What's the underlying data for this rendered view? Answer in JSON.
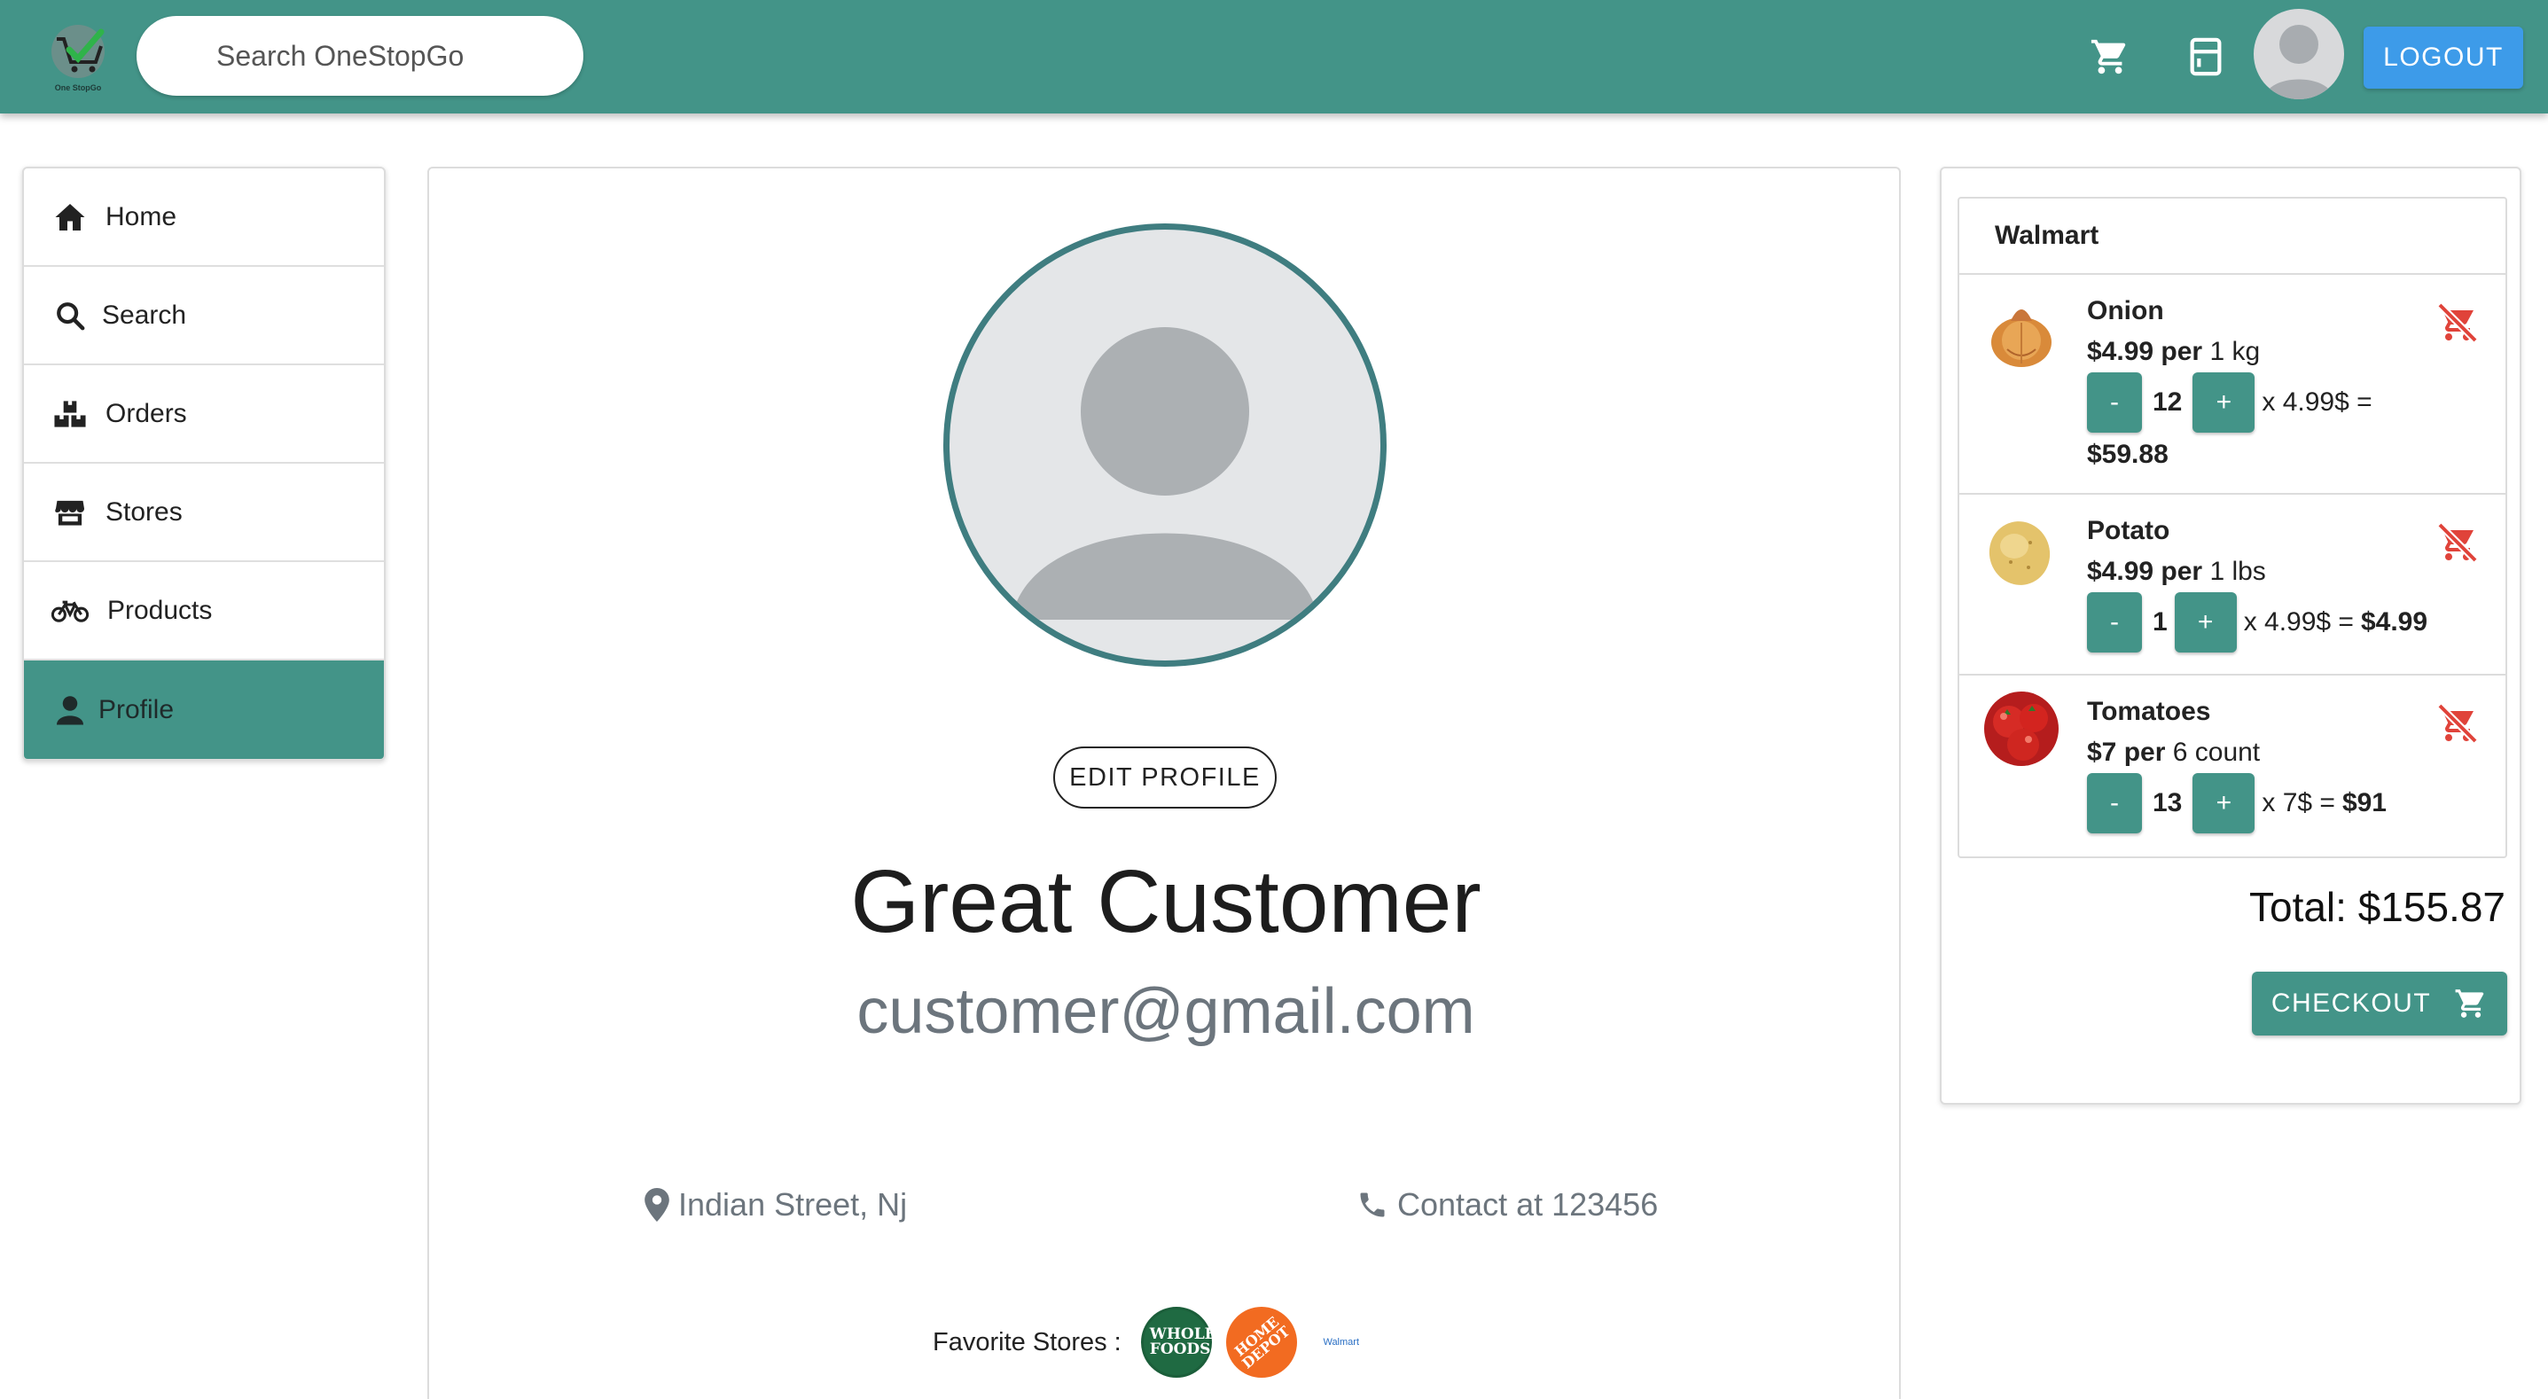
{
  "topbar": {
    "logo_text": "One StopGo",
    "search_placeholder": "Search OneStopGo",
    "logout_label": "LOGOUT",
    "icons": [
      "cart-icon",
      "receipt-icon",
      "avatar"
    ]
  },
  "sidebar": {
    "items": [
      {
        "label": "Home",
        "icon": "home-icon"
      },
      {
        "label": "Search",
        "icon": "search-icon"
      },
      {
        "label": "Orders",
        "icon": "boxes-icon"
      },
      {
        "label": "Stores",
        "icon": "store-icon"
      },
      {
        "label": "Products",
        "icon": "bicycle-icon"
      },
      {
        "label": "Profile",
        "icon": "user-icon",
        "active": true
      }
    ]
  },
  "profile": {
    "edit_label": "EDIT PROFILE",
    "name": "Great Customer",
    "email": "customer@gmail.com",
    "address": "Indian Street, Nj",
    "contact": "Contact at 123456",
    "favorite_label": "Favorite Stores :",
    "favorite_stores": [
      "WHOLE FOODS",
      "HOME DEPOT",
      "Walmart"
    ]
  },
  "cart": {
    "store": "Walmart",
    "items": [
      {
        "name": "Onion",
        "price": "$4.99 per",
        "unit": "1 kg",
        "qty": "12",
        "mult": "x 4.99$ =",
        "line_total": "$59.88"
      },
      {
        "name": "Potato",
        "price": "$4.99 per",
        "unit": "1 lbs",
        "qty": "1",
        "mult": "x 4.99$ =",
        "line_total": "$4.99"
      },
      {
        "name": "Tomatoes",
        "price": "$7 per",
        "unit": "6 count",
        "qty": "13",
        "mult": "x 7$ =",
        "line_total": "$91"
      }
    ],
    "minus": "-",
    "plus": "+",
    "total": "Total: $155.87",
    "checkout_label": "CHECKOUT"
  },
  "colors": {
    "primary": "#439488",
    "logout": "#3d9be9",
    "remove": "#e0433a",
    "ring": "#3f7d80"
  }
}
